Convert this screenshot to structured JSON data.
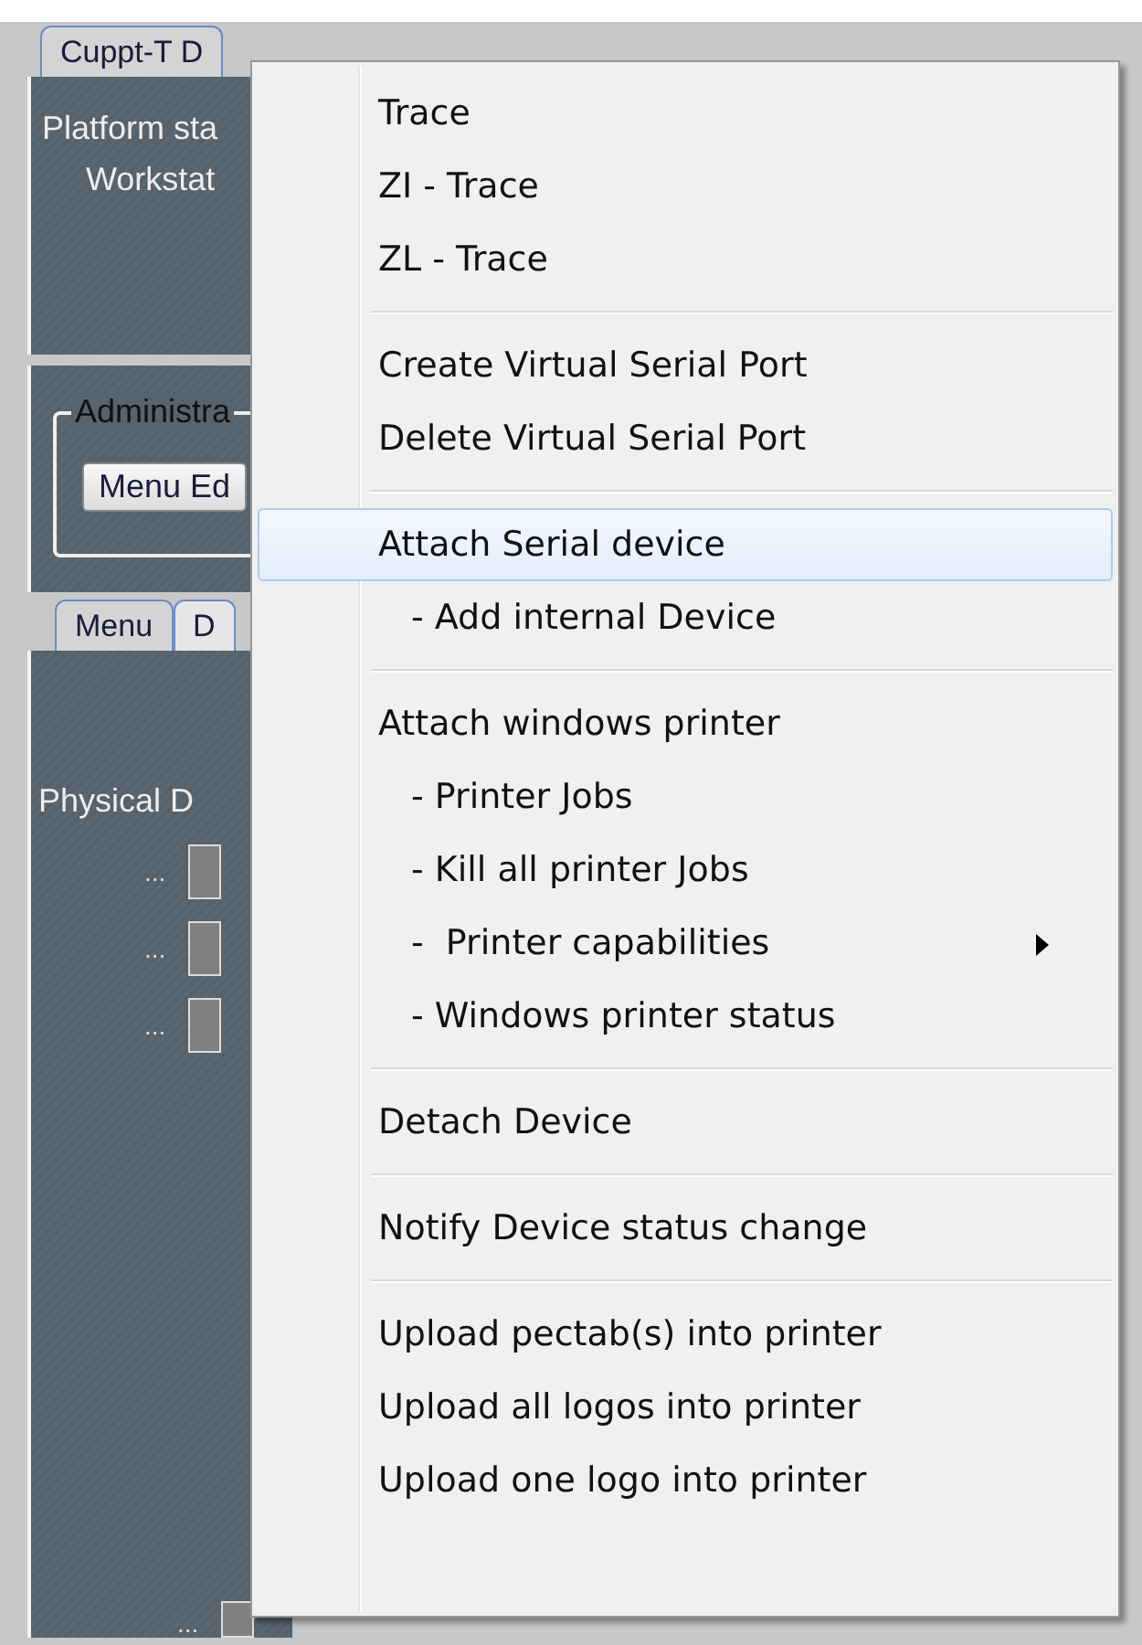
{
  "app": {
    "tab": "Cuppt-T D",
    "status_labels": [
      "Platform sta",
      "Workstat"
    ],
    "admin_group": {
      "legend": "Administra",
      "button": "Menu Ed"
    },
    "lower_tabs": [
      {
        "label": "Menu",
        "selected": true
      },
      {
        "label": "D",
        "selected": false
      }
    ],
    "physical_label": "Physical D",
    "device_rows": [
      "...",
      "...",
      "..."
    ],
    "bottom_row": "..."
  },
  "context_menu": {
    "groups": [
      [
        {
          "label": "Trace",
          "kind": "item",
          "selected": false
        },
        {
          "label": "ZI - Trace",
          "kind": "item",
          "selected": false
        },
        {
          "label": "ZL - Trace",
          "kind": "item",
          "selected": false
        }
      ],
      [
        {
          "label": "Create Virtual Serial Port",
          "kind": "item",
          "selected": false
        },
        {
          "label": "Delete Virtual Serial Port",
          "kind": "item",
          "selected": false
        }
      ],
      [
        {
          "label": "Attach Serial device",
          "kind": "item",
          "selected": true
        },
        {
          "label": "- Add internal Device",
          "kind": "sub",
          "selected": false
        }
      ],
      [
        {
          "label": "Attach windows printer",
          "kind": "item",
          "selected": false
        },
        {
          "label": "- Printer Jobs",
          "kind": "sub",
          "selected": false
        },
        {
          "label": "- Kill all printer Jobs",
          "kind": "sub",
          "selected": false
        },
        {
          "label": "-  Printer capabilities",
          "kind": "submenu",
          "selected": false
        },
        {
          "label": "- Windows printer status",
          "kind": "sub",
          "selected": false
        }
      ],
      [
        {
          "label": "Detach Device",
          "kind": "item",
          "selected": false
        }
      ],
      [
        {
          "label": "Notify Device status change",
          "kind": "item",
          "selected": false
        }
      ],
      [
        {
          "label": "Upload pectab(s) into printer",
          "kind": "item",
          "selected": false
        },
        {
          "label": "Upload all logos into printer",
          "kind": "item",
          "selected": false
        },
        {
          "label": "Upload one logo into printer",
          "kind": "item",
          "selected": false
        }
      ]
    ]
  }
}
